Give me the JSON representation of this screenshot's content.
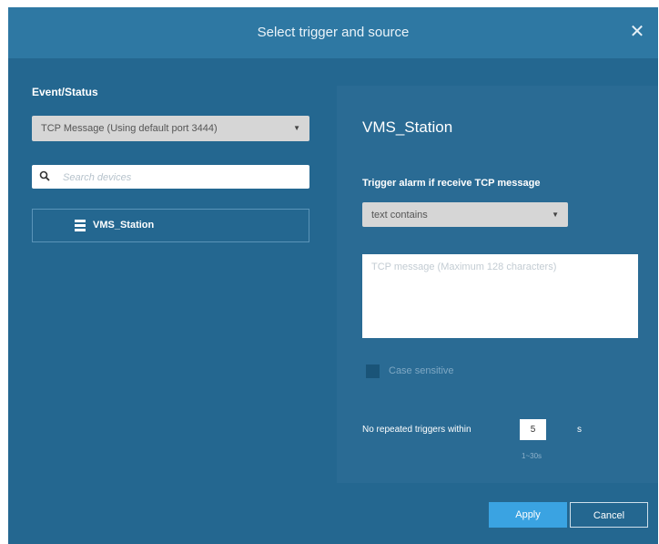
{
  "dialog": {
    "title": "Select trigger and source",
    "close_glyph": "✕"
  },
  "left": {
    "section_label": "Event/Status",
    "event_select": {
      "value": "TCP Message (Using default port 3444)",
      "caret": "▼"
    },
    "search": {
      "placeholder": "Search devices",
      "value": "",
      "icon": "search-icon"
    },
    "devices": [
      {
        "label": "VMS_Station",
        "icon": "server-icon"
      }
    ]
  },
  "right": {
    "device_title": "VMS_Station",
    "trigger_label": "Trigger alarm if receive TCP message",
    "condition_select": {
      "value": "text contains",
      "caret": "▼"
    },
    "message": {
      "placeholder": "TCP message (Maximum 128 characters)",
      "value": ""
    },
    "case_sensitive": {
      "label": "Case sensitive",
      "checked": false
    },
    "repeat": {
      "label": "No repeated triggers within",
      "value": "5",
      "unit": "s",
      "range": "1~30s"
    }
  },
  "footer": {
    "apply_label": "Apply",
    "cancel_label": "Cancel"
  },
  "colors": {
    "dialog_bg": "#246790",
    "titlebar_bg": "#2e78a3",
    "panel_bg": "#2a6b94",
    "accent": "#3aa3e2"
  }
}
